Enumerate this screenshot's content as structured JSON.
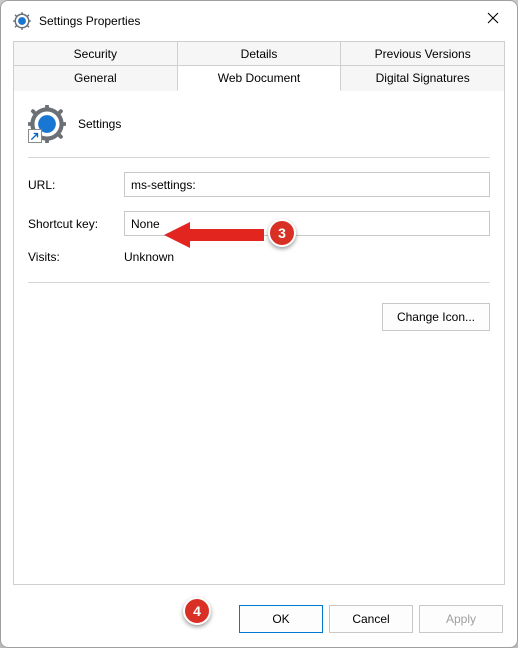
{
  "window": {
    "title": "Settings Properties",
    "item_name": "Settings"
  },
  "tabs": {
    "row1": [
      "Security",
      "Details",
      "Previous Versions"
    ],
    "row2": [
      "General",
      "Web Document",
      "Digital Signatures"
    ],
    "active": "Web Document"
  },
  "fields": {
    "url_label": "URL:",
    "url_value": "ms-settings:",
    "shortcut_label": "Shortcut key:",
    "shortcut_value": "None",
    "visits_label": "Visits:",
    "visits_value": "Unknown"
  },
  "buttons": {
    "change_icon": "Change Icon...",
    "ok": "OK",
    "cancel": "Cancel",
    "apply": "Apply"
  },
  "annotations": {
    "callout_3": "3",
    "callout_4": "4"
  }
}
